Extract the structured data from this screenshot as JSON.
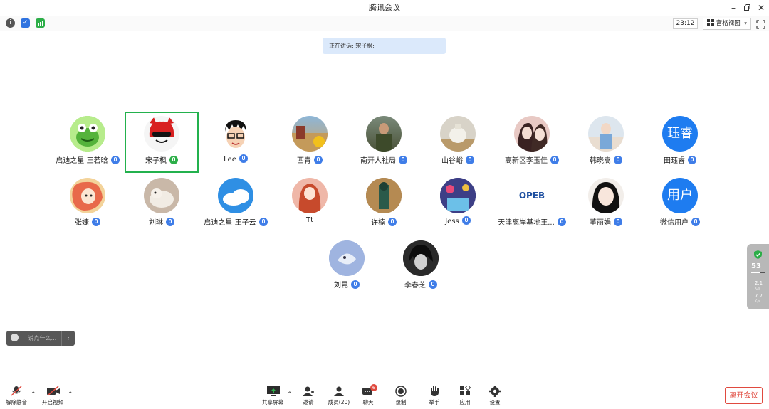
{
  "app": {
    "title": "腾讯会议"
  },
  "topbar": {
    "time": "23:12",
    "view_label": "宫格视图"
  },
  "speaking": {
    "label": "正在讲话: 宋子枫;"
  },
  "participants": [
    {
      "name": "启迪之星  王若晗"
    },
    {
      "name": "宋子枫"
    },
    {
      "name": "Lee"
    },
    {
      "name": "西青"
    },
    {
      "name": "南开人社局"
    },
    {
      "name": "山谷峪"
    },
    {
      "name": "高新区李玉佳"
    },
    {
      "name": "韩晓嵩"
    },
    {
      "name": "田珏睿",
      "avatar_text": "珏睿"
    },
    {
      "name": "张婕"
    },
    {
      "name": "刘琳"
    },
    {
      "name": "启迪之星 王子云"
    },
    {
      "name": "Tt"
    },
    {
      "name": "许楠"
    },
    {
      "name": "Jess"
    },
    {
      "name": "天津离岸基地王..."
    },
    {
      "name": "董丽娟"
    },
    {
      "name": "微信用户",
      "avatar_text": "用户"
    },
    {
      "name": "刘昆"
    },
    {
      "name": "李春芝"
    }
  ],
  "logo_text": "OPEB",
  "side": {
    "score": "53",
    "up": "2.1",
    "down": "7.7",
    "unit": "K/s"
  },
  "chat": {
    "placeholder": "说点什么..."
  },
  "bottom": {
    "mute": "解除静音",
    "video": "开启视频",
    "share": "共享屏幕",
    "invite": "邀请",
    "members": "成员(20)",
    "chat": "聊天",
    "chat_badge": "6",
    "record": "录制",
    "hand": "举手",
    "apps": "应用",
    "settings": "设置",
    "leave": "离开会议"
  }
}
